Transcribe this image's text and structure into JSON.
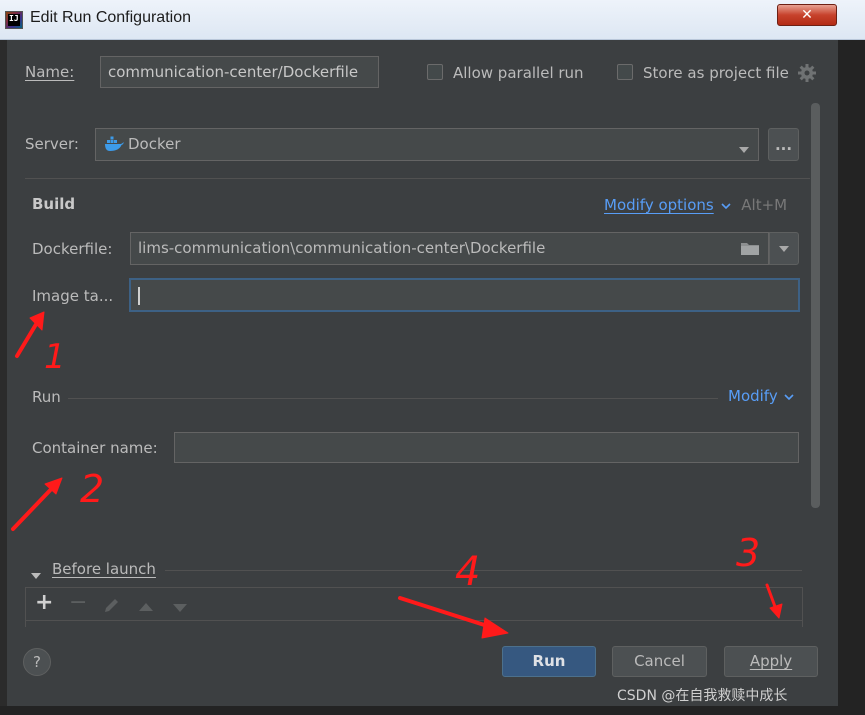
{
  "window": {
    "title": "Edit Run Configuration",
    "close_glyph": "✕"
  },
  "name": {
    "label": "Name:",
    "value": "communication-center/Dockerfile"
  },
  "options": {
    "allow_parallel_run": "Allow parallel run",
    "store_as_project_file": "Store as project file"
  },
  "server": {
    "label": "Server:",
    "value": "Docker",
    "browse_label": "..."
  },
  "build": {
    "heading": "Build",
    "modify_options": "Modify options",
    "shortcut": "Alt+M",
    "dockerfile_label": "Dockerfile:",
    "dockerfile_value": "lims-communication\\communication-center\\Dockerfile",
    "image_tag_label": "Image ta...",
    "image_tag_value": ""
  },
  "run": {
    "heading": "Run",
    "modify": "Modify",
    "container_name_label": "Container name:",
    "container_name_value": ""
  },
  "before_launch": {
    "heading": "Before launch"
  },
  "buttons": {
    "help": "?",
    "run": "Run",
    "cancel": "Cancel",
    "apply": "Apply"
  },
  "annotations": [
    "1",
    "2",
    "3",
    "4"
  ],
  "annotation_color": "#ff1a1a",
  "watermark": "CSDN @在自我救赎中成长",
  "icons": [
    "docker-icon",
    "folder-icon",
    "gear-icon",
    "chevron-down-icon",
    "add-icon",
    "remove-icon",
    "edit-icon",
    "move-up-icon",
    "move-down-icon",
    "help-icon"
  ]
}
